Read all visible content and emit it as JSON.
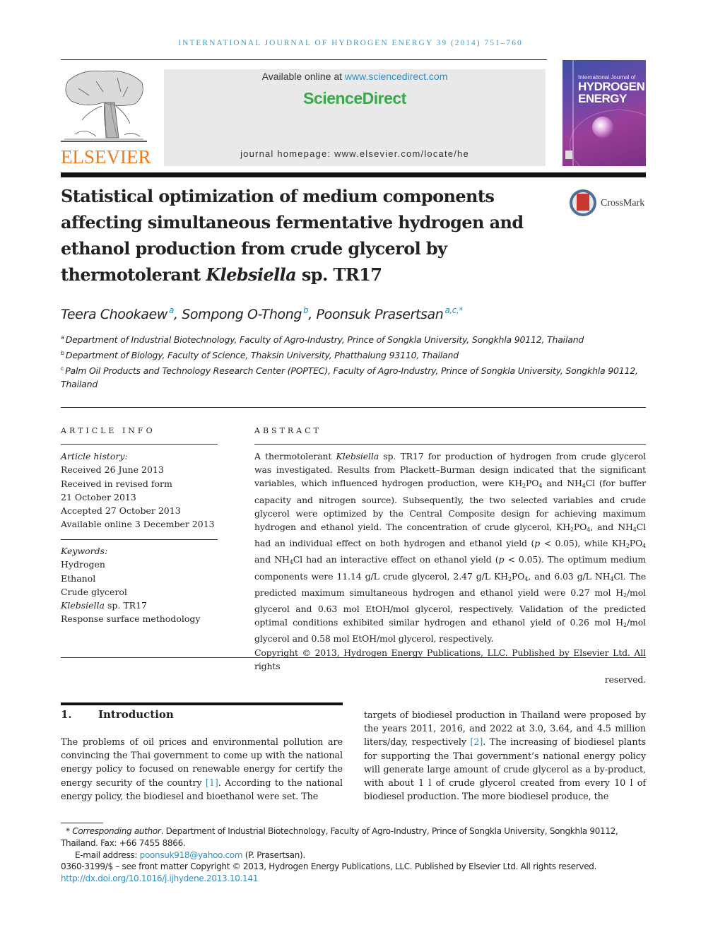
{
  "running_head": "INTERNATIONAL JOURNAL OF HYDROGEN ENERGY 39 (2014) 751–760",
  "publisher": {
    "logo_wordmark": "ELSEVIER",
    "logo_color": "#f07a1a"
  },
  "sciencedirect": {
    "available_prefix": "Available online at ",
    "available_link": "www.sciencedirect.com",
    "brand": "ScienceDirect",
    "brand_color": "#3aa84a",
    "homepage": "journal homepage: www.elsevier.com/locate/he"
  },
  "cover": {
    "line1": "International Journal of",
    "line2": "HYDROGEN",
    "line3": "ENERGY"
  },
  "crossmark": {
    "label": "CrossMark"
  },
  "article": {
    "title_part1": "Statistical optimization of medium components affecting simultaneous fermentative hydrogen and ethanol production from crude glycerol by thermotolerant ",
    "title_italic": "Klebsiella",
    "title_part2": " sp. TR17",
    "authors": [
      {
        "name": "Teera Chookaew",
        "sup": "a"
      },
      {
        "name": "Sompong O-Thong",
        "sup": "b"
      },
      {
        "name": "Poonsuk Prasertsan",
        "sup": "a,c,*"
      }
    ],
    "affiliations": [
      {
        "sup": "a",
        "text": "Department of Industrial Biotechnology, Faculty of Agro-Industry, Prince of Songkla University, Songkhla 90112, Thailand"
      },
      {
        "sup": "b",
        "text": "Department of Biology, Faculty of Science, Thaksin University, Phatthalung 93110, Thailand"
      },
      {
        "sup": "c",
        "text": "Palm Oil Products and Technology Research Center (POPTEC), Faculty of Agro-Industry, Prince of Songkla University, Songkhla 90112, Thailand"
      }
    ]
  },
  "article_info": {
    "label": "ARTICLE INFO",
    "history_head": "Article history:",
    "history": [
      "Received 26 June 2013",
      "Received in revised form",
      "21 October 2013",
      "Accepted 27 October 2013",
      "Available online 3 December 2013"
    ],
    "keywords_head": "Keywords:",
    "keywords": [
      "Hydrogen",
      "Ethanol",
      "Crude glycerol",
      "Klebsiella sp. TR17",
      "Response surface methodology"
    ],
    "keyword_italic": "Klebsiella",
    "keyword_rest": " sp. TR17"
  },
  "abstract": {
    "label": "ABSTRACT",
    "t1": "A thermotolerant ",
    "t1_i": "Klebsiella",
    "t2": " sp. TR17 for production of hydrogen from crude glycerol was investigated. Results from Plackett–Burman design indicated that the significant variables, which influenced hydrogen production, were KH",
    "t3": "PO",
    "t4": " and NH",
    "t5": "Cl (for buffer capacity and nitrogen source). Subsequently, the two selected variables and crude glycerol were optimized by the Central Composite design for achieving maximum hydrogen and ethanol yield. The concentration of crude glycerol, KH",
    "t6": "PO",
    "t7": ", and NH",
    "t8": "Cl had an individual effect on both hydrogen and ethanol yield (",
    "p": "p",
    "t9": " < 0.05), while KH",
    "t10": "PO",
    "t11": " and NH",
    "t12": "Cl had an interactive effect on ethanol yield (",
    "t13": " < 0.05). The optimum medium components were 11.14 g/L crude glycerol, 2.47 g/L KH",
    "t14": "PO",
    "t15": ", and 6.03 g/L NH",
    "t16": "Cl. The predicted maximum simultaneous hydrogen and ethanol yield were 0.27 mol H",
    "t17": "/mol glycerol and 0.63 mol EtOH/mol glycerol, respectively. Validation of the predicted optimal conditions exhibited similar hydrogen and ethanol yield of 0.26 mol H",
    "t18": "/mol glycerol and 0.58 mol EtOH/mol glycerol, respectively.",
    "sub2": "2",
    "sub4": "4",
    "copyright_line": "Copyright © 2013, Hydrogen Energy Publications, LLC. Published by Elsevier Ltd. All rights",
    "copyright_end": "reserved."
  },
  "introduction": {
    "number": "1.",
    "heading": "Introduction",
    "left_a": "The problems of oil prices and environmental pollution are convincing the Thai government to come up with the national energy policy to focused on renewable energy for certify the energy security of the country ",
    "cite1": "[1]",
    "left_b": ". According to the national energy policy, the biodiesel and bioethanol were set. The",
    "right_a": "targets of biodiesel production in Thailand were proposed by the years 2011, 2016, and 2022 at 3.0, 3.64, and 4.5 million liters/day, respectively ",
    "cite2": "[2]",
    "right_b": ". The increasing of biodiesel plants for supporting the Thai government’s national energy policy will generate large amount of crude glycerol as a by-product, with about 1 l of crude glycerol created from every 10 l of biodiesel production. The more biodiesel produce, the"
  },
  "footnotes": {
    "star": "*",
    "corr_label": "Corresponding author",
    "corr_text": ". Department of Industrial Biotechnology, Faculty of Agro-Industry, Prince of Songkla University, Songkhla 90112, Thailand. Fax: +66 7455 8866.",
    "email_label": "E-mail address: ",
    "email": "poonsuk918@yahoo.com",
    "email_name": " (P. Prasertsan).",
    "front_matter": "0360-3199/$ – see front matter Copyright © 2013, Hydrogen Energy Publications, LLC. Published by Elsevier Ltd. All rights reserved.",
    "doi": "http://dx.doi.org/10.1016/j.ijhydene.2013.10.141"
  },
  "colors": {
    "link": "#2c8fc9",
    "running_head": "#3a9fc6"
  }
}
